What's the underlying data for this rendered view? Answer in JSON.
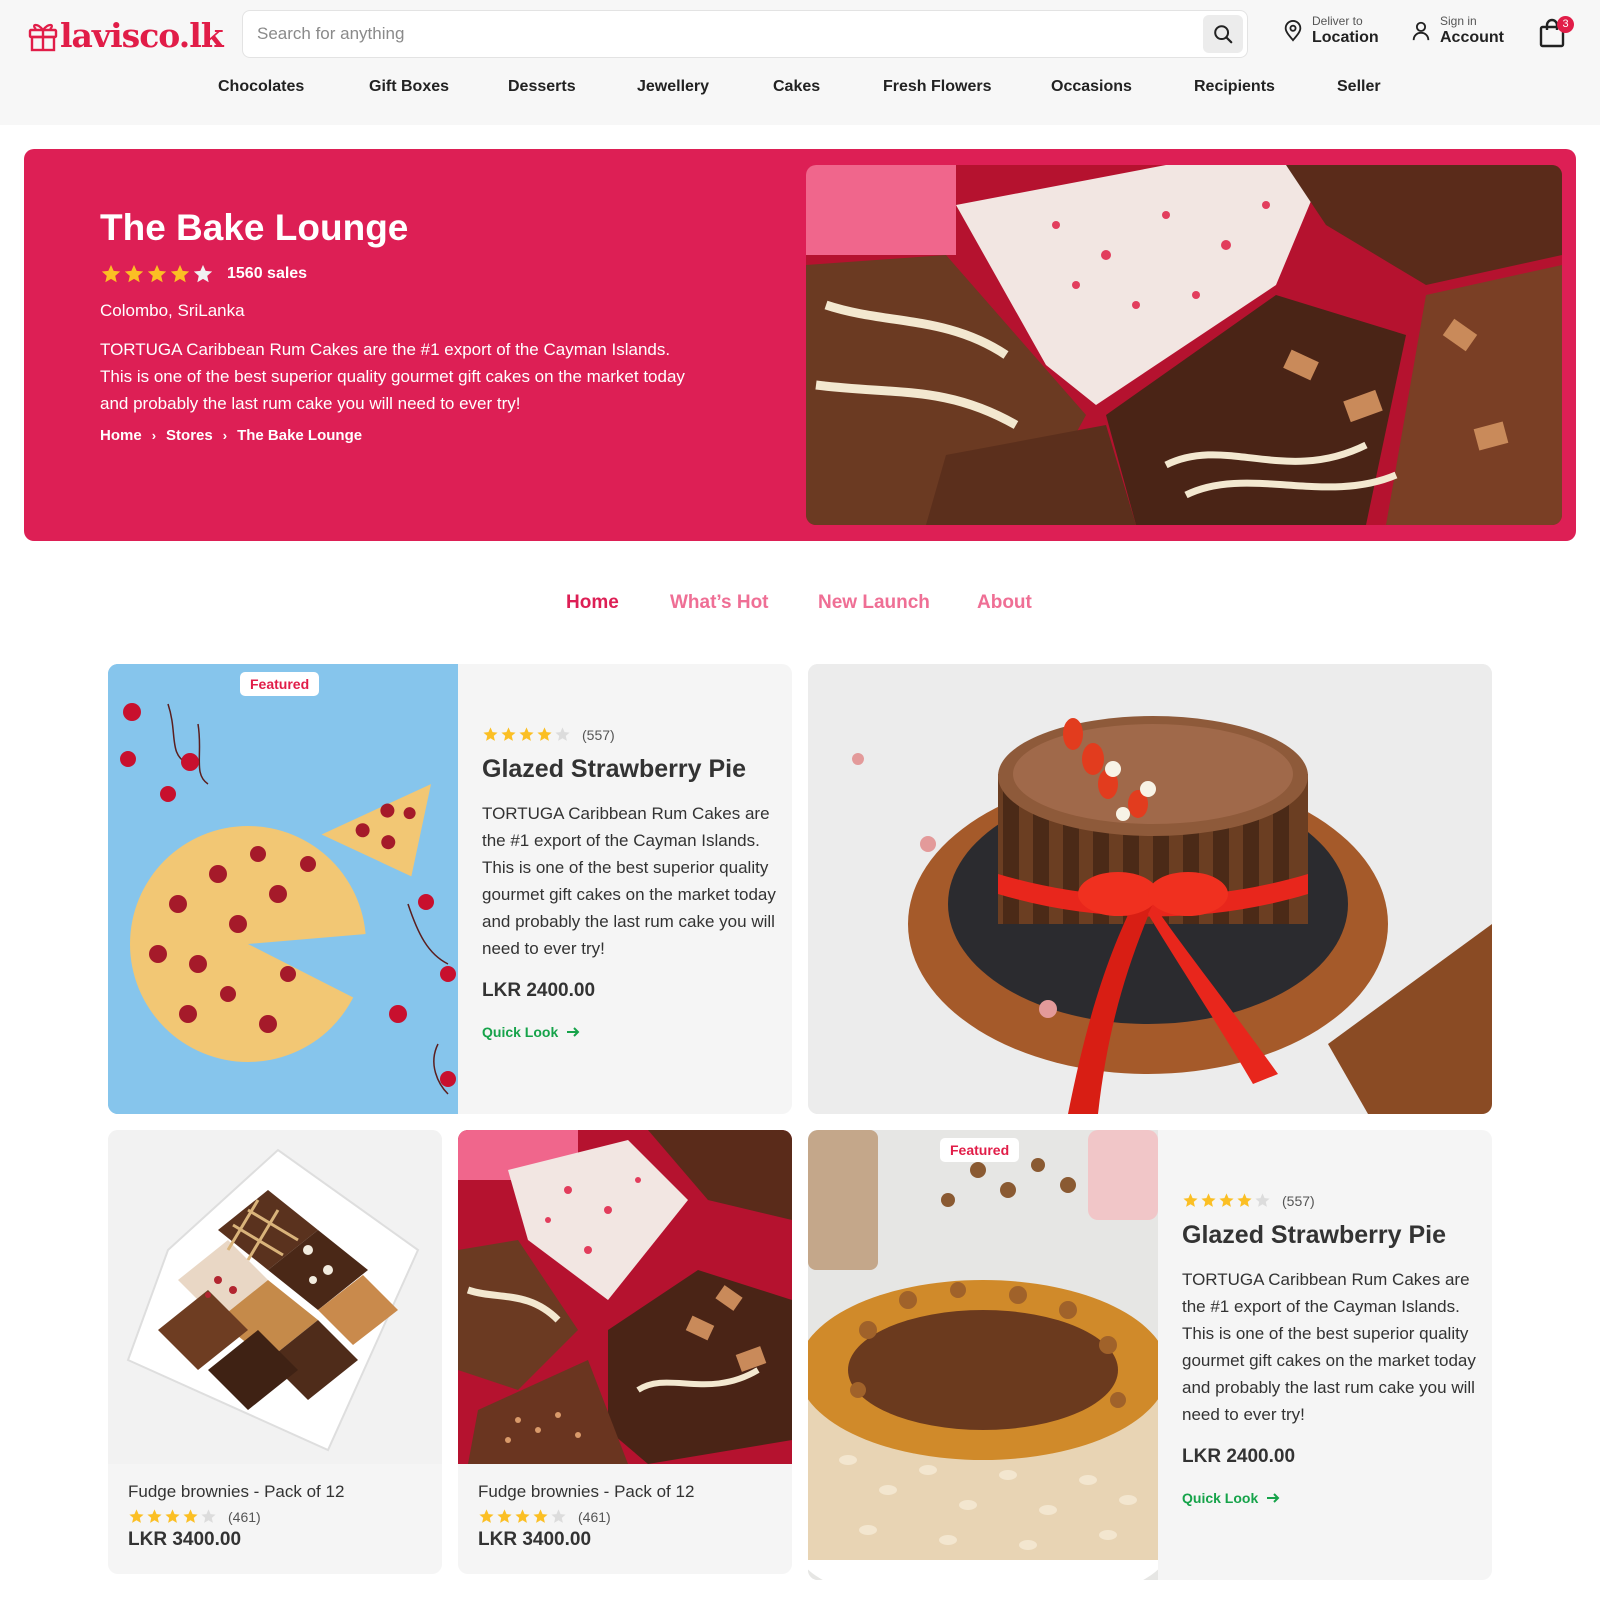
{
  "brand": {
    "name": "laviscolk",
    "display": "lavisco.lk",
    "accent": "#e11d48",
    "banner_color": "#dd1f55",
    "link_color": "#16a34a"
  },
  "header": {
    "search_placeholder": "Search for anything",
    "deliver_label": "Deliver to",
    "deliver_value": "Location",
    "signin_label": "Sign in",
    "signin_value": "Account",
    "cart_count": "3"
  },
  "nav": [
    "Chocolates",
    "Gift Boxes",
    "Desserts",
    "Jewellery",
    "Cakes",
    "Fresh Flowers",
    "Occasions",
    "Recipients",
    "Seller"
  ],
  "store": {
    "name": "The Bake Lounge",
    "rating": 4,
    "rating_max": 5,
    "sales": "1560 sales",
    "location": "Colombo, SriLanka",
    "description": "TORTUGA Caribbean Rum Cakes are the #1 export of the Cayman Islands. This is one of the best superior quality gourmet gift cakes on the market today and probably the last rum cake you will need to ever try!",
    "breadcrumb": [
      "Home",
      "Stores",
      "The Bake Lounge"
    ]
  },
  "tabs": [
    {
      "label": "Home",
      "active": true
    },
    {
      "label": "What’s Hot",
      "active": false
    },
    {
      "label": "New Launch",
      "active": false
    },
    {
      "label": "About",
      "active": false
    }
  ],
  "featured_1": {
    "badge": "Featured",
    "rating": 4,
    "reviews": "(557)",
    "title": "Glazed Strawberry Pie",
    "description": "TORTUGA Caribbean Rum Cakes are the #1 export of the Cayman Islands. This is one of the best superior quality gourmet gift cakes on the market today and probably the last rum cake you will need to ever try!",
    "price": "LKR 2400.00",
    "cta": "Quick Look"
  },
  "featured_2": {
    "badge": "Featured",
    "rating": 4,
    "reviews": "(557)",
    "title": "Glazed Strawberry Pie",
    "description": "TORTUGA Caribbean Rum Cakes are the #1 export of the Cayman Islands. This is one of the best superior quality gourmet gift cakes on the market today and probably the last rum cake you will need to ever try!",
    "price": "LKR 2400.00",
    "cta": "Quick Look"
  },
  "small_products": [
    {
      "name": "Fudge brownies - Pack of 12",
      "rating": 4,
      "reviews": "(461)",
      "price": "LKR 3400.00"
    },
    {
      "name": "Fudge brownies - Pack of 12",
      "rating": 4,
      "reviews": "(461)",
      "price": "LKR 3400.00"
    }
  ],
  "icons": {
    "logo": "gift-icon",
    "search": "search-icon",
    "location": "location-pin-icon",
    "account": "user-icon",
    "cart": "shopping-bag-icon",
    "breadcrumb_sep": "chevron-right-icon",
    "cta": "arrow-right-icon",
    "rating": "star-icon"
  }
}
